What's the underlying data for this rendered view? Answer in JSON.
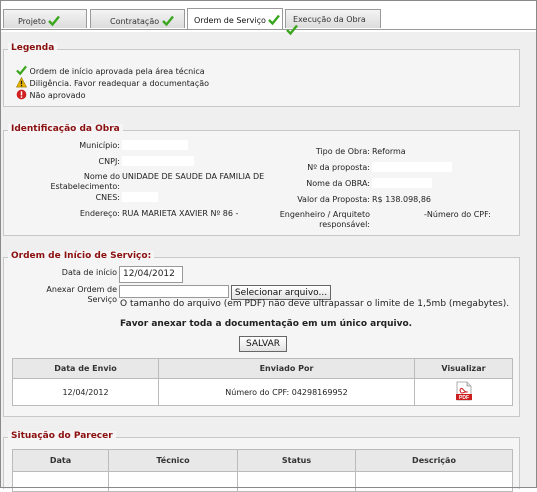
{
  "tabs": [
    {
      "label": "Projeto"
    },
    {
      "label": "Contratação"
    },
    {
      "label": "Ordem de Serviço"
    },
    {
      "label": "Execução  da Obra"
    }
  ],
  "legenda": {
    "title": "Legenda",
    "items": [
      {
        "icon": "check-icon",
        "text": "Ordem de início aprovada pela área técnica"
      },
      {
        "icon": "warning-icon",
        "text": "Diligência. Favor readequar a documentação"
      },
      {
        "icon": "error-icon",
        "text": "Não aprovado"
      }
    ]
  },
  "identificacao": {
    "title": "Identificação da Obra",
    "municipio_label": "Município:",
    "cnpj_label": "CNPJ:",
    "estabelecimento_label": "Nome do\nEstabelecimento:",
    "estabelecimento_value": "UNIDADE DE SAUDE DA FAMILIA DE",
    "cnes_label": "CNES:",
    "endereco_label": "Endereço:",
    "endereco_value": "RUA MARIETA XAVIER Nº 86 -",
    "tipo_label": "Tipo de Obra:",
    "tipo_value": "Reforma",
    "proposta_label": "Nº da proposta:",
    "nome_obra_label": "Nome da OBRA:",
    "valor_label": "Valor da Proposta:",
    "valor_value": "R$ 138.098,86",
    "engenheiro_label": "Engenheiro / Arquiteto\nresponsável:",
    "engenheiro_value": "-Número do CPF:"
  },
  "ordem": {
    "title": "Ordem de Início de Serviço:",
    "data_label": "Data de início",
    "data_value": "12/04/2012",
    "anexar_label": "Anexar Ordem de\nServiço",
    "select_button": "Selecionar arquivo...",
    "note": "O tamanho do arquivo (em PDF) não deve ultrapassar o limite de 1,5mb (megabytes).",
    "note_bold": "Favor anexar toda a documentação em um único arquivo.",
    "save_button": "SALVAR",
    "table": {
      "headers": [
        "Data de Envio",
        "Enviado Por",
        "Visualizar"
      ],
      "rows": [
        {
          "data": "12/04/2012",
          "enviado": "Número do CPF: 04298169952",
          "visualizar": "pdf-icon"
        }
      ]
    }
  },
  "parecer": {
    "title": "Situação do Parecer",
    "headers": [
      "Data",
      "Técnico",
      "Status",
      "Descrição"
    ]
  },
  "colors": {
    "accent": "#8b1010",
    "check": "#3aa61e",
    "warning": "#e8b400",
    "error": "#d12020",
    "pdf": "#cc1f1f"
  }
}
